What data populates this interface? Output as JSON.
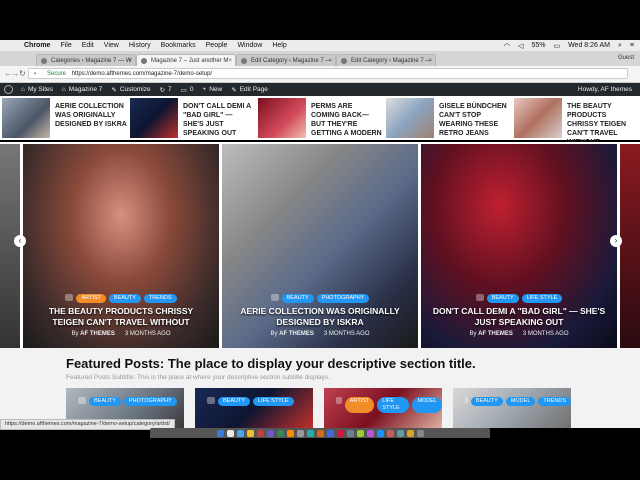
{
  "menubar": {
    "app": "Chrome",
    "items": [
      "File",
      "Edit",
      "View",
      "History",
      "Bookmarks",
      "People",
      "Window",
      "Help"
    ],
    "battery": "55%",
    "clock": "Wed 8:26 AM"
  },
  "tabs": [
    {
      "label": "Categories ‹ Magazine 7 — W"
    },
    {
      "label": "Magazine 7 – Just another M"
    },
    {
      "label": "Edit Category ‹ Magazine 7 —"
    },
    {
      "label": "Edit Category ‹ Magazine 7 —"
    }
  ],
  "guest_label": "Guest",
  "address": {
    "secure": "Secure",
    "url": "https://demo.afthemes.com/magazine-7/demo-setup/"
  },
  "wpbar": {
    "my_sites": "My Sites",
    "site": "Magazine 7",
    "customize": "Customize",
    "updates": "7",
    "comments": "0",
    "new": "New",
    "edit_page": "Edit Page",
    "howdy": "Howdy, AF themes"
  },
  "ticker": [
    {
      "text": "AERIE COLLECTION WAS ORIGINALLY DESIGNED BY ISKRA"
    },
    {
      "text": "DON'T CALL DEMI A \"BAD GIRL\" — SHE'S JUST SPEAKING OUT"
    },
    {
      "text": "PERMS ARE COMING BACK—BUT THEY'RE GETTING A MODERN"
    },
    {
      "text": "GISELE BÜNDCHEN CAN'T STOP WEARING THESE RETRO JEANS"
    },
    {
      "text": "THE BEAUTY PRODUCTS CHRISSY TEIGEN CAN'T TRAVEL WITHOUT"
    }
  ],
  "slides": [
    {
      "tags": [
        "ARTIST",
        "BEAUTY",
        "TRENDS"
      ],
      "title": "THE BEAUTY PRODUCTS CHRISSY TEIGEN CAN'T TRAVEL WITHOUT",
      "author": "AF THEMES",
      "date": "3 MONTHS AGO"
    },
    {
      "tags": [
        "BEAUTY",
        "PHOTOGRAPHY"
      ],
      "title": "AERIE COLLECTION WAS ORIGINALLY DESIGNED BY ISKRA",
      "author": "AF THEMES",
      "date": "3 MONTHS AGO"
    },
    {
      "tags": [
        "BEAUTY",
        "LIFE STYLE"
      ],
      "title": "DON'T CALL DEMI A \"BAD GIRL\" — SHE'S JUST SPEAKING OUT",
      "author": "AF THEMES",
      "date": "3 MONTHS AGO"
    }
  ],
  "by_label": "By",
  "featured": {
    "title": "Featured Posts: The place to display your descriptive section title.",
    "subtitle": "Featured Posts Subtitle: This is the place at where your descriptive section subtitle displays.",
    "cards": [
      {
        "tags": [
          "BEAUTY",
          "PHOTOGRAPHY"
        ]
      },
      {
        "tags": [
          "BEAUTY",
          "LIFE STYLE"
        ]
      },
      {
        "tags": [
          "ARTIST",
          "LIFE STYLE",
          "MODEL"
        ]
      },
      {
        "tags": [
          "BEAUTY",
          "MODEL",
          "TRENDS"
        ]
      }
    ]
  },
  "status_url": "https://demo.afthemes.com/magazine-7/demo-setup/category/artist/",
  "colors": {
    "tag_blue": "#2196f3",
    "tag_orange": "#f28c28",
    "wp_bar": "#23282d"
  }
}
